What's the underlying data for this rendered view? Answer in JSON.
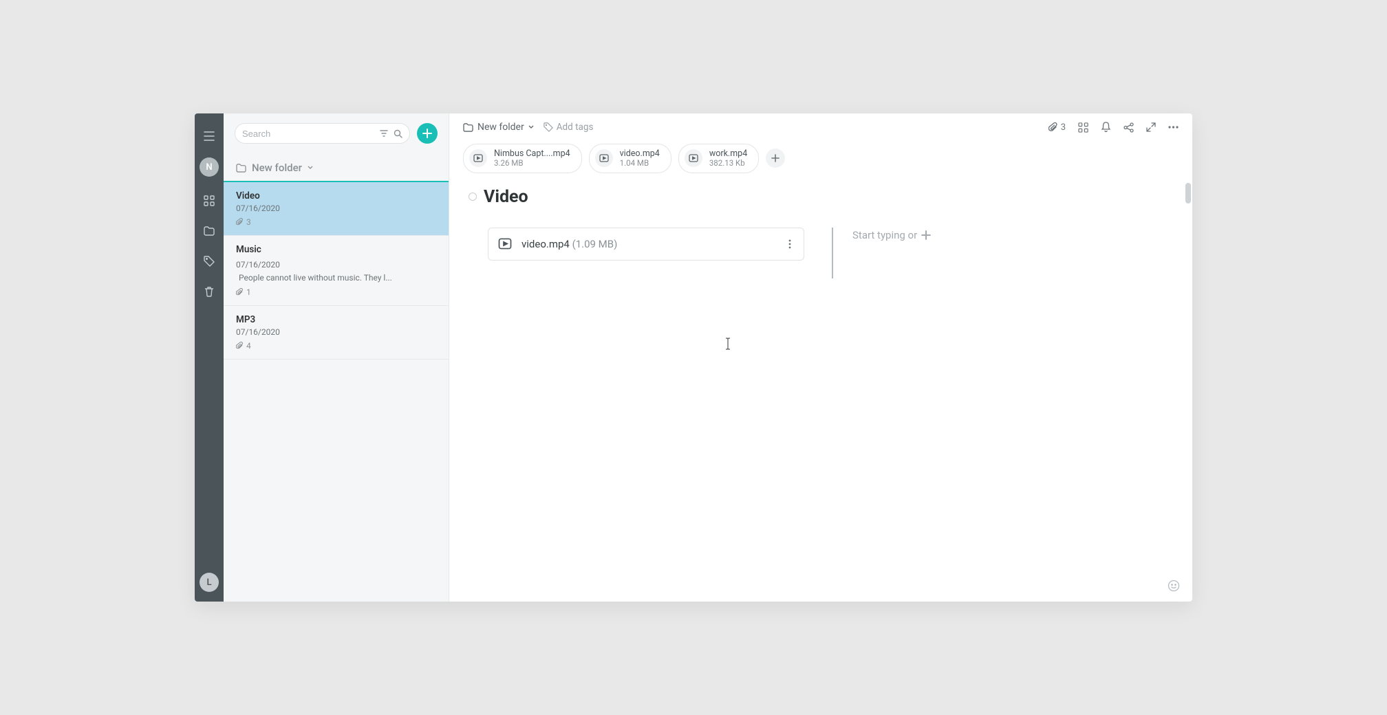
{
  "rail": {
    "avatarTop": "N",
    "avatarBottom": "L"
  },
  "search": {
    "placeholder": "Search"
  },
  "folderHeader": {
    "label": "New folder"
  },
  "notes": [
    {
      "title": "Video",
      "date": "07/16/2020",
      "snippet": "",
      "attach": "3",
      "active": true
    },
    {
      "title": "Music",
      "date": "07/16/2020",
      "snippet": "People cannot live without music. They l...",
      "attach": "1",
      "active": false
    },
    {
      "title": "MP3",
      "date": "07/16/2020",
      "snippet": "",
      "attach": "4",
      "active": false
    }
  ],
  "breadcrumb": {
    "folder": "New folder"
  },
  "addTags": "Add tags",
  "topbarAttachCount": "3",
  "chips": [
    {
      "name": "Nimbus Capt....mp4",
      "size": "3.26 MB"
    },
    {
      "name": "video.mp4",
      "size": "1.04 MB"
    },
    {
      "name": "work.mp4",
      "size": "382.13 Kb"
    }
  ],
  "pageTitle": "Video",
  "fileBlock": {
    "name": "video.mp4",
    "size": "(1.09 MB)"
  },
  "typingPlaceholder": "Start typing or"
}
